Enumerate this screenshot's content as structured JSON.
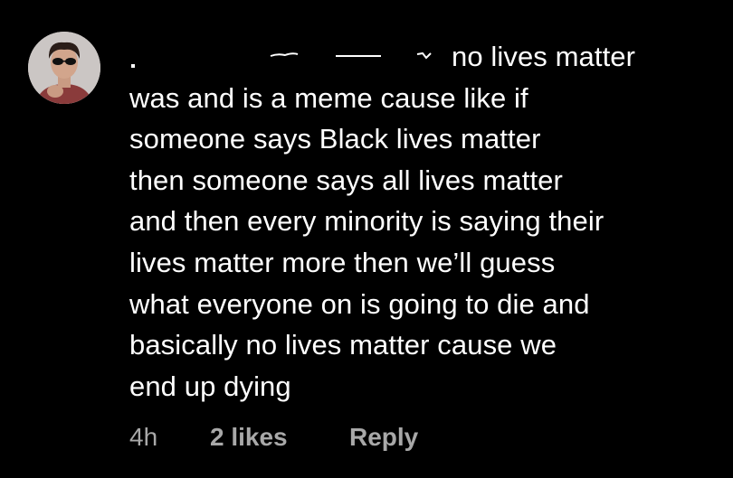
{
  "comment": {
    "lines": [
      "no lives matter",
      "was and is a meme cause like if",
      "someone says Black lives matter",
      "then someone says all lives matter",
      "and then every minority is saying their",
      "lives matter more then we’ll guess",
      "what everyone on is going to die and",
      "basically no lives matter cause we",
      "end up dying"
    ],
    "avatar_icon": "user-avatar-photo",
    "username_redacted": true
  },
  "meta": {
    "time": "4h",
    "likes": "2 likes",
    "reply": "Reply"
  },
  "colors": {
    "background": "#000000",
    "text": "#ffffff",
    "meta_text": "#a8a8a8"
  }
}
